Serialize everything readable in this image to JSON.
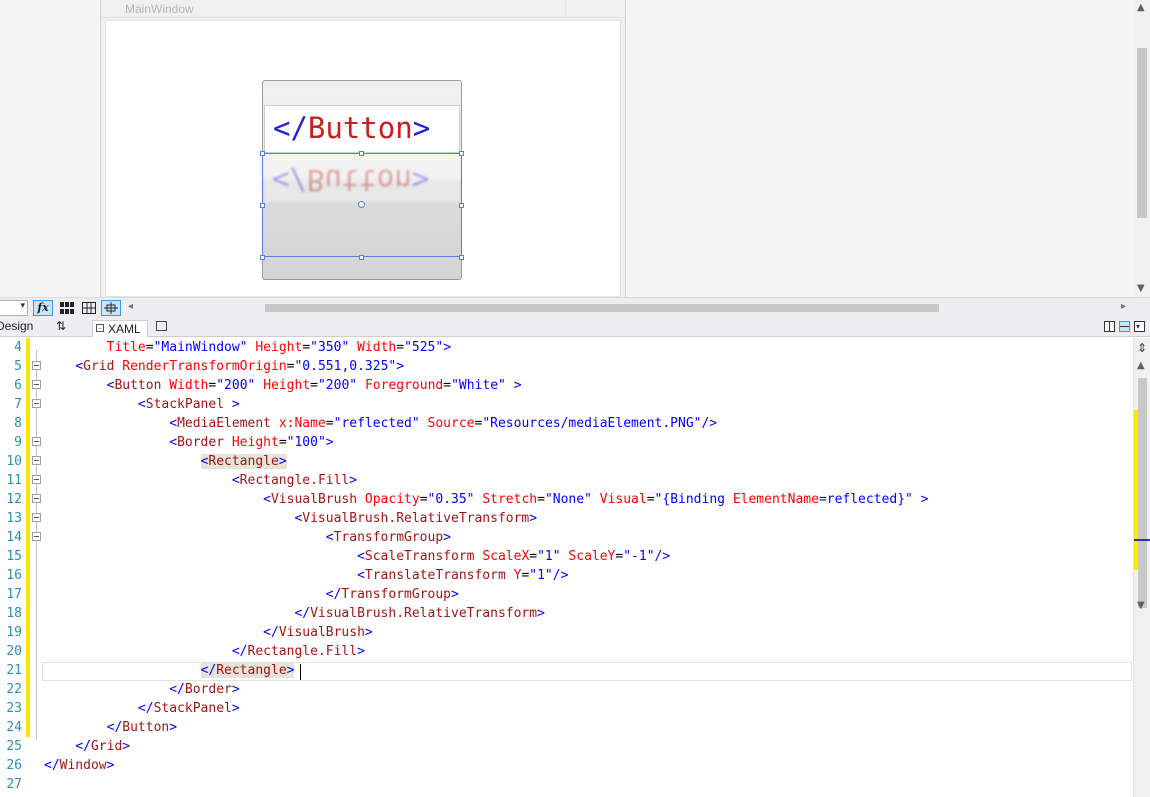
{
  "designer": {
    "window_title": "MainWindow",
    "media_text": {
      "open": "</",
      "name": "Button",
      "close": ">"
    }
  },
  "toolbar": {
    "zoom_arrow": "▾",
    "fx_label": "fx",
    "scroll_left": "◂",
    "scroll_right": "▸"
  },
  "tabs": {
    "design_label": "Design",
    "swap_icon": "⇅",
    "xaml_label": "XAML"
  },
  "editor": {
    "lines": [
      {
        "num": "4",
        "indent": "        ",
        "tokens": [
          [
            "a",
            "Title"
          ],
          [
            "p",
            "="
          ],
          [
            "v",
            "\"MainWindow\""
          ],
          [
            "p",
            " "
          ],
          [
            "a",
            "Height"
          ],
          [
            "p",
            "="
          ],
          [
            "v",
            "\"350\""
          ],
          [
            "p",
            " "
          ],
          [
            "a",
            "Width"
          ],
          [
            "p",
            "="
          ],
          [
            "v",
            "\"525\""
          ],
          [
            "b",
            ">"
          ]
        ]
      },
      {
        "num": "5",
        "indent": "    ",
        "tokens": [
          [
            "b",
            "<"
          ],
          [
            "t",
            "Grid"
          ],
          [
            "p",
            " "
          ],
          [
            "a",
            "RenderTransformOrigin"
          ],
          [
            "p",
            "="
          ],
          [
            "v",
            "\"0.551,0.325\""
          ],
          [
            "b",
            ">"
          ]
        ]
      },
      {
        "num": "6",
        "indent": "        ",
        "tokens": [
          [
            "b",
            "<"
          ],
          [
            "t",
            "Button"
          ],
          [
            "p",
            " "
          ],
          [
            "a",
            "Width"
          ],
          [
            "p",
            "="
          ],
          [
            "v",
            "\"200\""
          ],
          [
            "p",
            " "
          ],
          [
            "a",
            "Height"
          ],
          [
            "p",
            "="
          ],
          [
            "v",
            "\"200\""
          ],
          [
            "p",
            " "
          ],
          [
            "a",
            "Foreground"
          ],
          [
            "p",
            "="
          ],
          [
            "v",
            "\"White\""
          ],
          [
            "p",
            " "
          ],
          [
            "b",
            ">"
          ]
        ]
      },
      {
        "num": "7",
        "indent": "            ",
        "tokens": [
          [
            "b",
            "<"
          ],
          [
            "t",
            "StackPanel"
          ],
          [
            "p",
            " "
          ],
          [
            "b",
            ">"
          ]
        ]
      },
      {
        "num": "8",
        "indent": "                ",
        "tokens": [
          [
            "b",
            "<"
          ],
          [
            "t",
            "MediaElement"
          ],
          [
            "p",
            " "
          ],
          [
            "a",
            "x:Name"
          ],
          [
            "p",
            "="
          ],
          [
            "v",
            "\"reflected\""
          ],
          [
            "p",
            " "
          ],
          [
            "a",
            "Source"
          ],
          [
            "p",
            "="
          ],
          [
            "v",
            "\"Resources/mediaElement.PNG\""
          ],
          [
            "b",
            "/>"
          ]
        ]
      },
      {
        "num": "9",
        "indent": "                ",
        "tokens": [
          [
            "b",
            "<"
          ],
          [
            "t",
            "Border"
          ],
          [
            "p",
            " "
          ],
          [
            "a",
            "Height"
          ],
          [
            "p",
            "="
          ],
          [
            "v",
            "\"100\""
          ],
          [
            "b",
            ">"
          ]
        ]
      },
      {
        "num": "10",
        "indent": "                    ",
        "tokens": [
          [
            "hb",
            "<"
          ],
          [
            "ht",
            "Rectangle"
          ],
          [
            "hb",
            ">"
          ]
        ]
      },
      {
        "num": "11",
        "indent": "                        ",
        "tokens": [
          [
            "b",
            "<"
          ],
          [
            "t",
            "Rectangle.Fill"
          ],
          [
            "b",
            ">"
          ]
        ]
      },
      {
        "num": "12",
        "indent": "                            ",
        "tokens": [
          [
            "b",
            "<"
          ],
          [
            "t",
            "VisualBrush"
          ],
          [
            "p",
            " "
          ],
          [
            "a",
            "Opacity"
          ],
          [
            "p",
            "="
          ],
          [
            "v",
            "\"0.35\""
          ],
          [
            "p",
            " "
          ],
          [
            "a",
            "Stretch"
          ],
          [
            "p",
            "="
          ],
          [
            "v",
            "\"None\""
          ],
          [
            "p",
            " "
          ],
          [
            "a",
            "Visual"
          ],
          [
            "p",
            "="
          ],
          [
            "v",
            "\"{Binding "
          ],
          [
            "a",
            "ElementName"
          ],
          [
            "v",
            "=reflected}\""
          ],
          [
            "p",
            " "
          ],
          [
            "b",
            ">"
          ]
        ]
      },
      {
        "num": "13",
        "indent": "                                ",
        "tokens": [
          [
            "b",
            "<"
          ],
          [
            "t",
            "VisualBrush.RelativeTransform"
          ],
          [
            "b",
            ">"
          ]
        ]
      },
      {
        "num": "14",
        "indent": "                                    ",
        "tokens": [
          [
            "b",
            "<"
          ],
          [
            "t",
            "TransformGroup"
          ],
          [
            "b",
            ">"
          ]
        ]
      },
      {
        "num": "15",
        "indent": "                                        ",
        "tokens": [
          [
            "b",
            "<"
          ],
          [
            "t",
            "ScaleTransform"
          ],
          [
            "p",
            " "
          ],
          [
            "a",
            "ScaleX"
          ],
          [
            "p",
            "="
          ],
          [
            "v",
            "\"1\""
          ],
          [
            "p",
            " "
          ],
          [
            "a",
            "ScaleY"
          ],
          [
            "p",
            "="
          ],
          [
            "v",
            "\"-1\""
          ],
          [
            "b",
            "/>"
          ]
        ]
      },
      {
        "num": "16",
        "indent": "                                        ",
        "tokens": [
          [
            "b",
            "<"
          ],
          [
            "t",
            "TranslateTransform"
          ],
          [
            "p",
            " "
          ],
          [
            "a",
            "Y"
          ],
          [
            "p",
            "="
          ],
          [
            "v",
            "\"1\""
          ],
          [
            "b",
            "/>"
          ]
        ]
      },
      {
        "num": "17",
        "indent": "                                    ",
        "tokens": [
          [
            "b",
            "</"
          ],
          [
            "t",
            "TransformGroup"
          ],
          [
            "b",
            ">"
          ]
        ]
      },
      {
        "num": "18",
        "indent": "                                ",
        "tokens": [
          [
            "b",
            "</"
          ],
          [
            "t",
            "VisualBrush.RelativeTransform"
          ],
          [
            "b",
            ">"
          ]
        ]
      },
      {
        "num": "19",
        "indent": "                            ",
        "tokens": [
          [
            "b",
            "</"
          ],
          [
            "t",
            "VisualBrush"
          ],
          [
            "b",
            ">"
          ]
        ]
      },
      {
        "num": "20",
        "indent": "                        ",
        "tokens": [
          [
            "b",
            "</"
          ],
          [
            "t",
            "Rectangle.Fill"
          ],
          [
            "b",
            ">"
          ]
        ]
      },
      {
        "num": "21",
        "indent": "                    ",
        "tokens": [
          [
            "hb",
            "</"
          ],
          [
            "ht",
            "Rectangle"
          ],
          [
            "hb",
            ">"
          ]
        ]
      },
      {
        "num": "22",
        "indent": "                ",
        "tokens": [
          [
            "b",
            "</"
          ],
          [
            "t",
            "Border"
          ],
          [
            "b",
            ">"
          ]
        ]
      },
      {
        "num": "23",
        "indent": "            ",
        "tokens": [
          [
            "b",
            "</"
          ],
          [
            "t",
            "StackPanel"
          ],
          [
            "b",
            ">"
          ]
        ]
      },
      {
        "num": "24",
        "indent": "        ",
        "tokens": [
          [
            "b",
            "</"
          ],
          [
            "t",
            "Button"
          ],
          [
            "b",
            ">"
          ]
        ]
      },
      {
        "num": "25",
        "indent": "    ",
        "tokens": [
          [
            "b",
            "</"
          ],
          [
            "t",
            "Grid"
          ],
          [
            "b",
            ">"
          ]
        ]
      },
      {
        "num": "26",
        "indent": "",
        "tokens": [
          [
            "b",
            "</"
          ],
          [
            "t",
            "Window"
          ],
          [
            "b",
            ">"
          ]
        ]
      },
      {
        "num": "27",
        "indent": "",
        "tokens": []
      }
    ],
    "foldable": [
      "5",
      "6",
      "7",
      "9",
      "10",
      "11",
      "12",
      "13",
      "14"
    ]
  },
  "colors": {
    "change_bar": "#ffe500",
    "selection": "#5a7fd6",
    "line_number": "#2b91af",
    "xml_tag": "#a31515",
    "xml_attr": "#ff0000",
    "xml_delim": "#0000ff"
  }
}
